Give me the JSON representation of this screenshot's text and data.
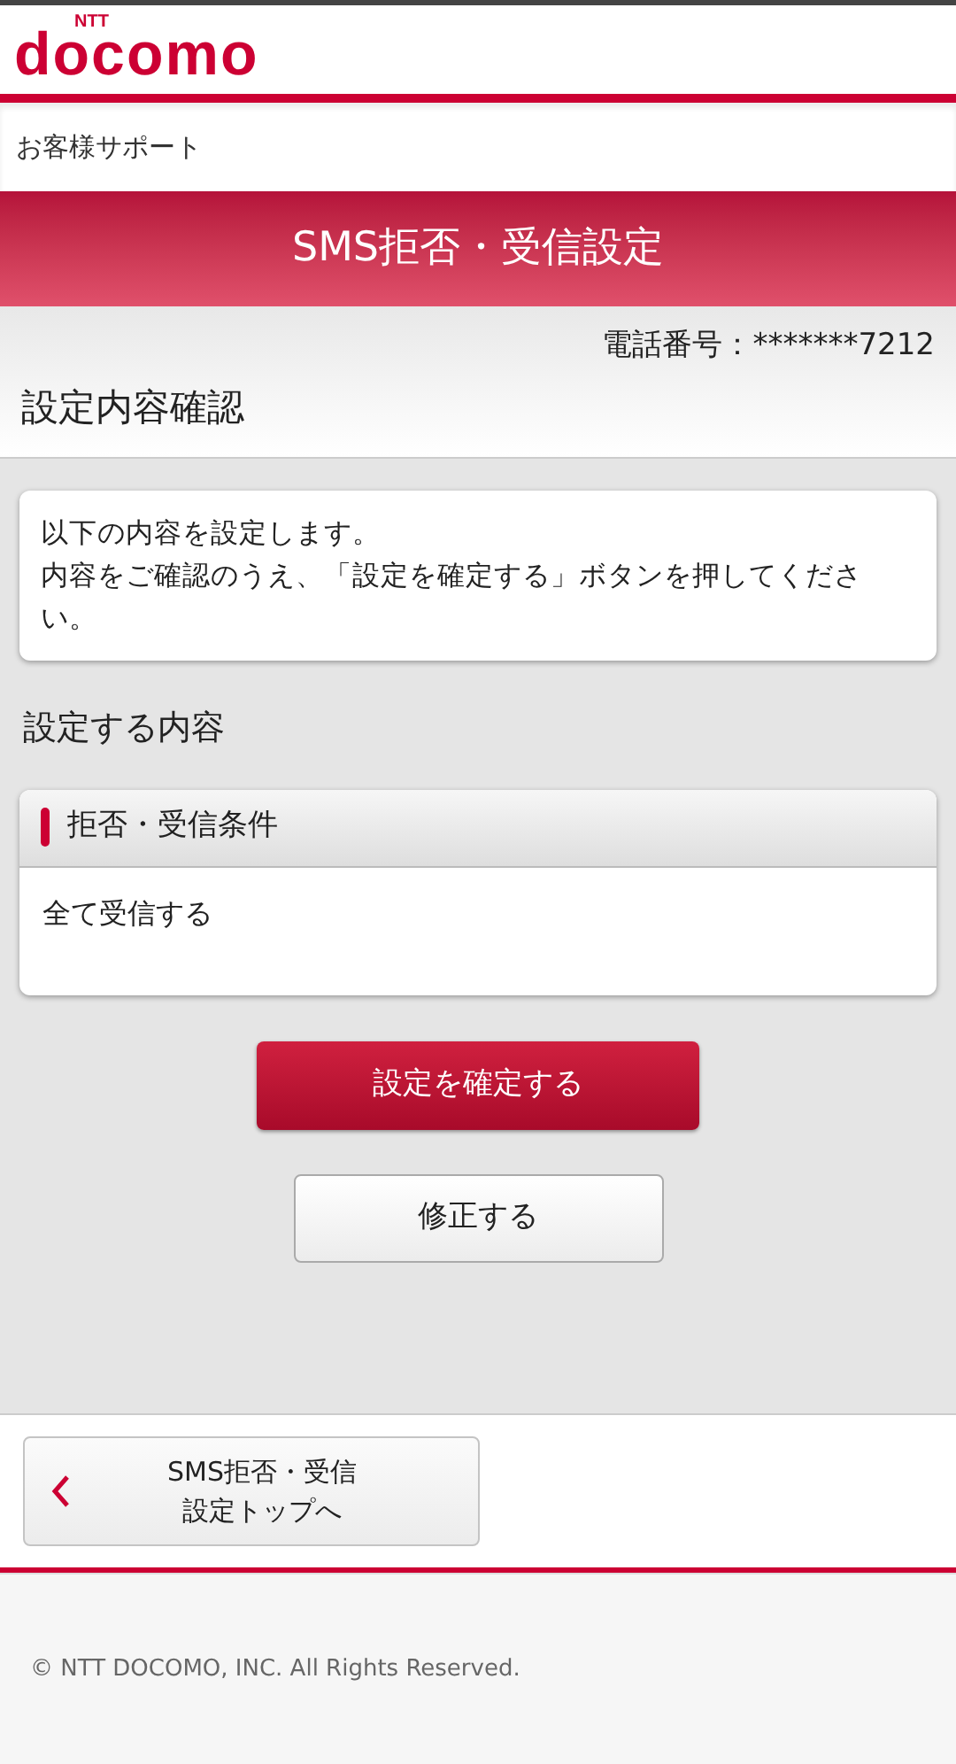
{
  "logo": {
    "small": "NTT",
    "main": "docomo"
  },
  "breadcrumb": "お客様サポート",
  "title_bar": "SMS拒否・受信設定",
  "phone_number": "電話番号：*******7212",
  "section_title": "設定内容確認",
  "notice": {
    "lines": [
      "以下の内容を設定します。",
      "内容をご確認のうえ、「設定を確定する」ボタンを押してください。"
    ]
  },
  "settings_heading": "設定する内容",
  "settings_card": {
    "header": "拒否・受信条件",
    "value": "全て受信する"
  },
  "buttons": [
    {
      "kind": "primary",
      "label": "設定を確定する"
    },
    {
      "kind": "secondary",
      "label": "修正する"
    }
  ],
  "back_button": {
    "lines": [
      "SMS拒否・受信",
      "設定トップへ"
    ]
  },
  "copyright": "© NTT DOCOMO, INC. All Rights Reserved."
}
